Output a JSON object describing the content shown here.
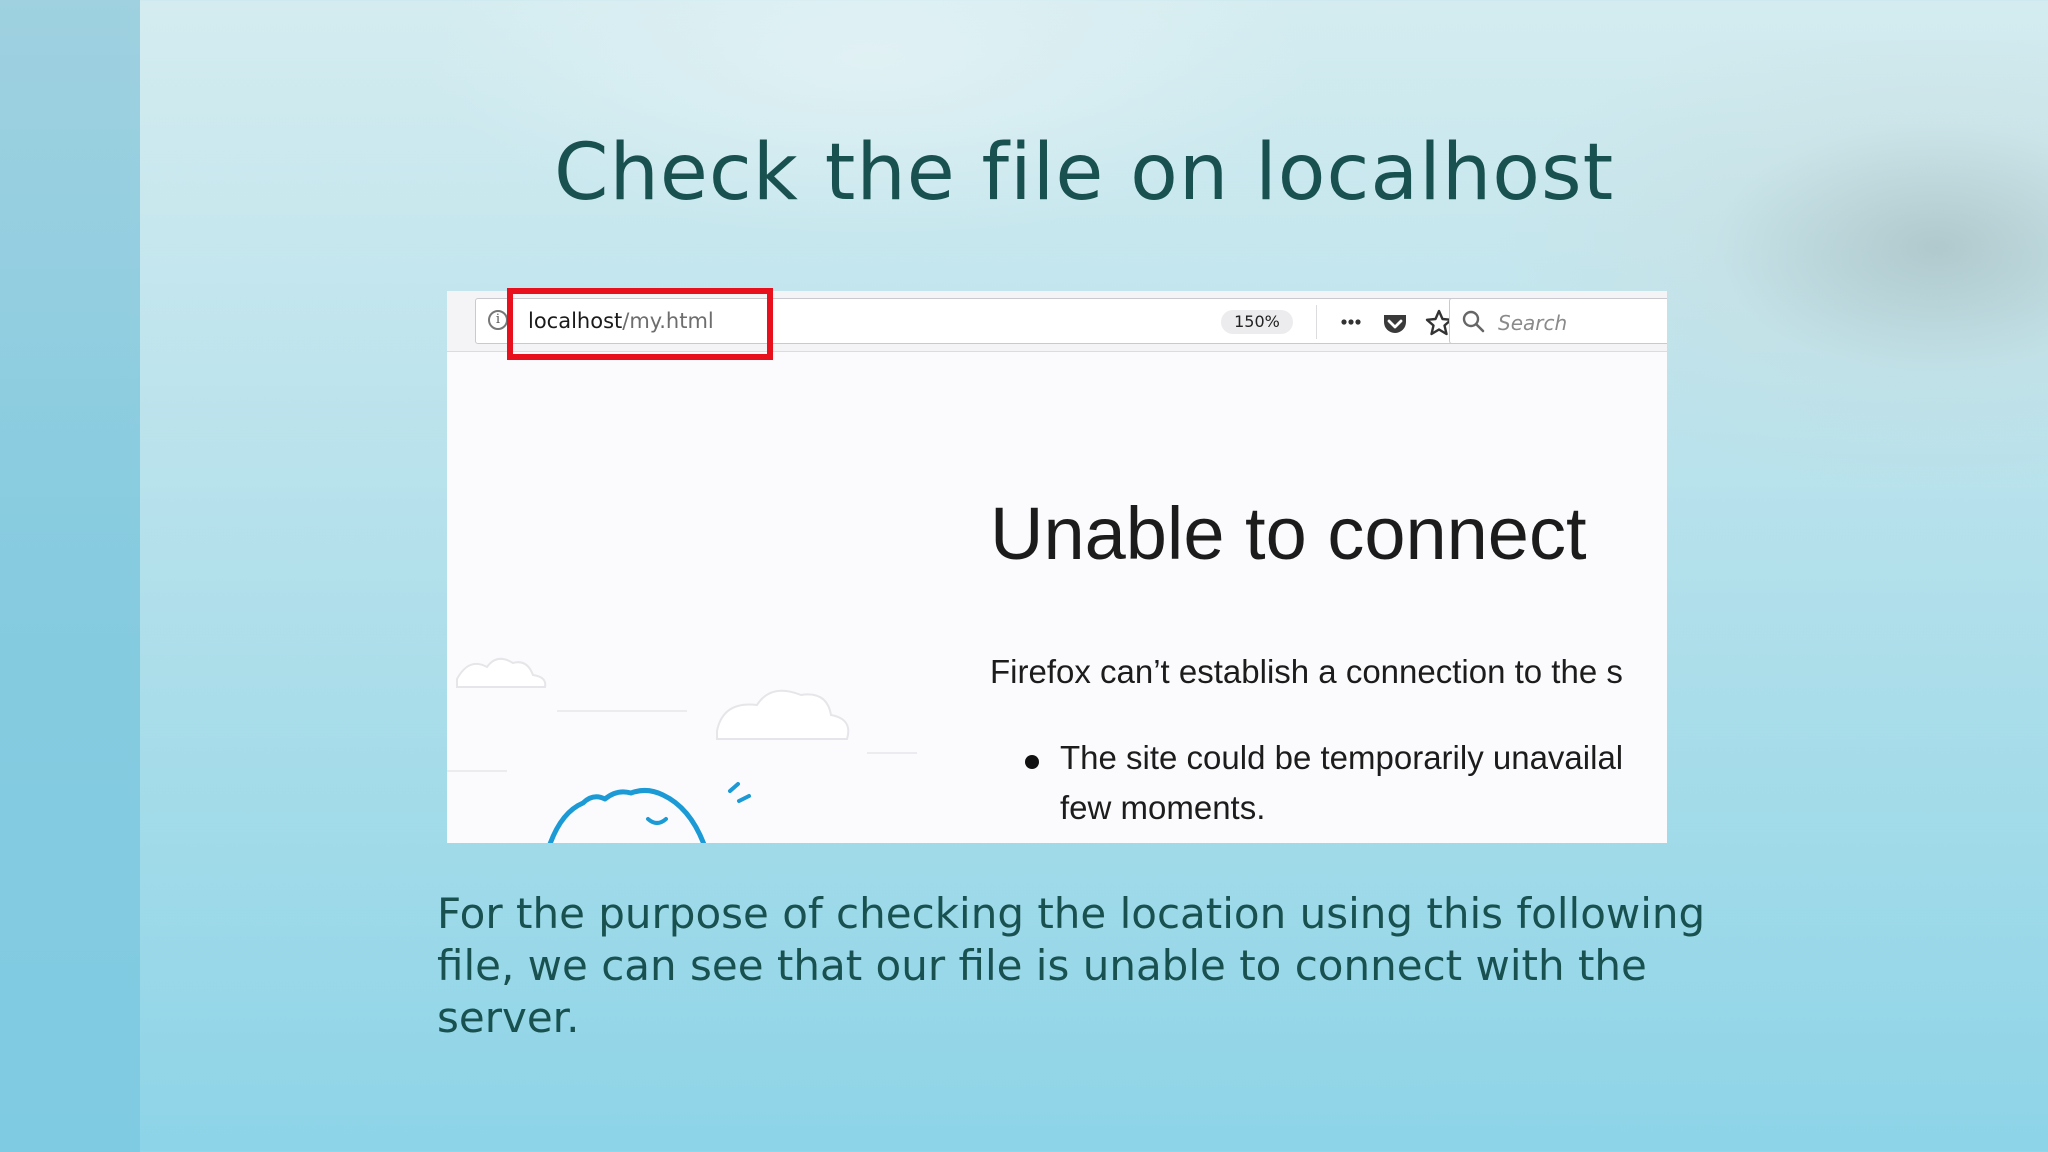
{
  "slide": {
    "title": "Check the file on localhost",
    "caption_lines": [
      "For the purpose of checking the location using this following",
      "file, we can see that our file is unable to connect with the",
      "server."
    ]
  },
  "browser": {
    "url_host": "localhost",
    "url_path": "/my.html",
    "zoom": "150%",
    "search_placeholder": "Search",
    "icons": [
      "info-icon",
      "more-icon",
      "pocket-icon",
      "star-icon",
      "search-icon"
    ]
  },
  "error_page": {
    "heading": "Unable to connect",
    "description": "Firefox can’t establish a connection to the s",
    "bullet_lines": [
      "The site could be temporarily unavailal",
      "few moments."
    ]
  },
  "colors": {
    "title": "#18514f",
    "highlight": "#e8101c",
    "illustration": "#1b9ad6"
  }
}
